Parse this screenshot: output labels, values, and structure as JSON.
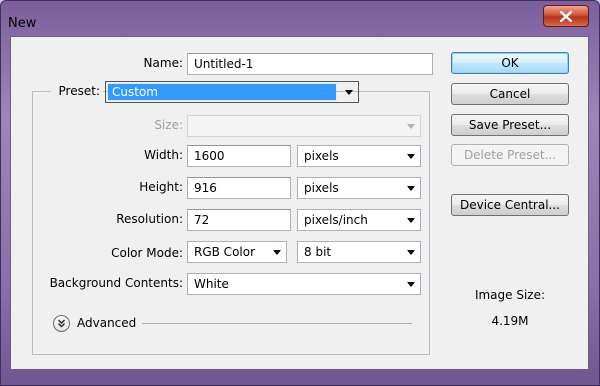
{
  "window": {
    "title": "New"
  },
  "form": {
    "name_label": "Name:",
    "name_value": "Untitled-1",
    "preset_label": "Preset:",
    "preset_value": "Custom",
    "size_label": "Size:",
    "size_value": "",
    "width_label": "Width:",
    "width_value": "1600",
    "width_unit": "pixels",
    "height_label": "Height:",
    "height_value": "916",
    "height_unit": "pixels",
    "resolution_label": "Resolution:",
    "resolution_value": "72",
    "resolution_unit": "pixels/inch",
    "color_mode_label": "Color Mode:",
    "color_mode_value": "RGB Color",
    "bit_depth_value": "8 bit",
    "background_label": "Background Contents:",
    "background_value": "White",
    "advanced_label": "Advanced"
  },
  "buttons": {
    "ok": "OK",
    "cancel": "Cancel",
    "save_preset": "Save Preset...",
    "delete_preset": "Delete Preset...",
    "device_central": "Device Central..."
  },
  "image_size": {
    "label": "Image Size:",
    "value": "4.19M"
  },
  "icons": [
    "close-icon",
    "dropdown-arrow-icon",
    "expand-chevron-icon"
  ]
}
